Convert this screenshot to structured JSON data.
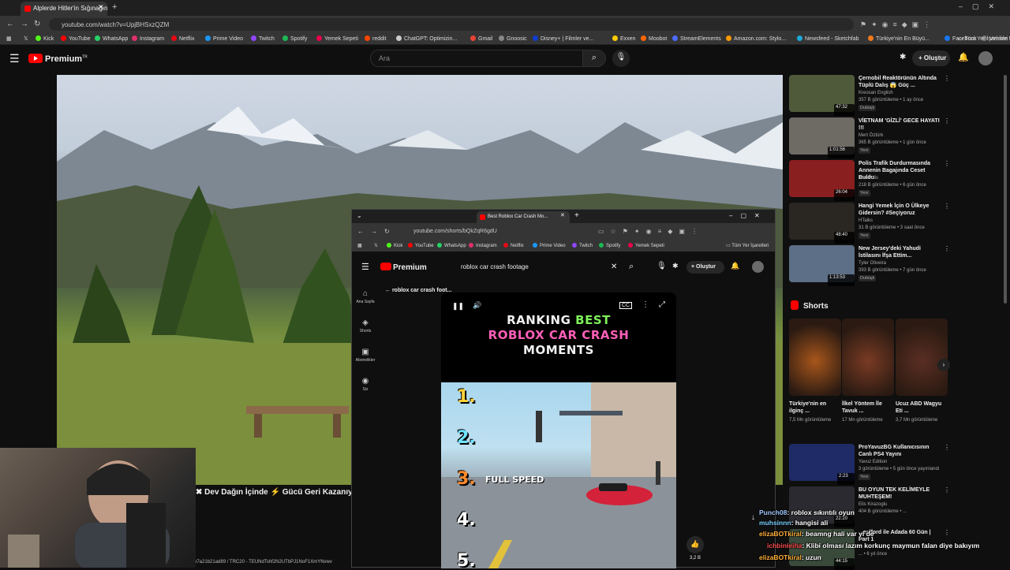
{
  "browser": {
    "active_tab_title": "Alplerde Hitler'in Sığınağın...",
    "url": "youtube.com/watch?v=UpjBHSxzQZM",
    "bookmarks": [
      {
        "label": "Kick",
        "color": "#53fc18"
      },
      {
        "label": "YouTube",
        "color": "#ff0000"
      },
      {
        "label": "WhatsApp",
        "color": "#25d366"
      },
      {
        "label": "Instagram",
        "color": "#e1306c"
      },
      {
        "label": "Netflix",
        "color": "#e50914"
      },
      {
        "label": "Prime Video",
        "color": "#1a98ff"
      },
      {
        "label": "Twitch",
        "color": "#9146ff"
      },
      {
        "label": "Spotify",
        "color": "#1db954"
      },
      {
        "label": "Yemek Sepeti",
        "color": "#ea004b"
      },
      {
        "label": "reddit",
        "color": "#ff4500"
      },
      {
        "label": "ChatGPT: Optimizin...",
        "color": "#cccccc"
      },
      {
        "label": "Gmail",
        "color": "#ea4335"
      },
      {
        "label": "Gnoosic",
        "color": "#888888"
      },
      {
        "label": "Disney+ | Filmler ve...",
        "color": "#113ccf"
      },
      {
        "label": "Exxen",
        "color": "#ffcc00"
      },
      {
        "label": "Moobot",
        "color": "#ff6600"
      },
      {
        "label": "StreamElements",
        "color": "#4d6aff"
      },
      {
        "label": "Amazon.com: Stylo...",
        "color": "#ff9900"
      },
      {
        "label": "Newsfeed - Sketchfab",
        "color": "#1caad9"
      },
      {
        "label": "Türkiye'nin En Büyü...",
        "color": "#f27a1a"
      },
      {
        "label": "Facebook",
        "color": "#1877f2"
      },
      {
        "label": "Vehicle Models - GT...",
        "color": "#777777"
      }
    ],
    "all_bookmarks": "Tüm Yer İşaretleri"
  },
  "yt": {
    "logo_text": "Premium",
    "logo_sup": "TR",
    "search_placeholder": "Ara",
    "create_label": "Oluştur"
  },
  "video": {
    "overlay_title": "Dev Dağın İçinde",
    "overlay_title_2": "Gücü Geri Kazanıyor",
    "hash_text": "b7a21b21ad89 / TRC20 - TEUNdTshf2N2UTbPJ1NoF1XmYNvwv"
  },
  "recommendations": [
    {
      "title": "Çernobil Reaktörünün Altında Tüplü Dalış 😱 Güç ...",
      "channel": "Kreosan English",
      "meta": "357 B görüntüleme • 1 ay önce",
      "badge": "Dublajlı",
      "duration": "47:32",
      "color": "#4f5a3a"
    },
    {
      "title": "VİETNAM 'GİZLİ' GECE HAYATI !!!",
      "channel": "Mert Öztürk",
      "meta": "365 B görüntüleme • 1 gün önce",
      "badge": "Yeni",
      "duration": "1:01:56",
      "color": "#6e6a64"
    },
    {
      "title": "Polis Trafik Durdurmasında Annenin Bagajında Ceset Buldu",
      "channel": "The Polis",
      "meta": "218 B görüntüleme • 6 gün önce",
      "badge": "Yeni",
      "duration": "26:04",
      "color": "#8a1f1f"
    },
    {
      "title": "Hangi Yemek İçin O Ülkeye Gidersin? #Seçiyoruz",
      "channel": "HTalks",
      "meta": "31 B görüntüleme • 3 saat önce",
      "badge": "Yeni",
      "duration": "48:40",
      "color": "#2a2622"
    },
    {
      "title": "New Jersey'deki Yahudi İstilasını İfşa Ettim...",
      "channel": "Tyler Oliveira",
      "meta": "393 B görüntüleme • 7 gün önce",
      "badge": "Dublajlı",
      "duration": "1:13:53",
      "color": "#5d6f86"
    },
    {
      "title": "ProYavuzBG Kullanıcısının Canlı PS4 Yayını",
      "channel": "Yavuz Edition",
      "meta": "3 görüntüleme • 5 gün önce yayınlandı",
      "badge": "Yeni",
      "duration": "2:23",
      "color": "#1f2b66"
    },
    {
      "title": "BU OYUN TEK KELİMEYLE MUHTEŞEM!",
      "channel": "Elis Kirazoglu",
      "meta": "404 B görüntüleme • ...",
      "badge": "",
      "duration": "22:20",
      "color": "#2a2a30"
    },
    {
      "title": "...ealford ile Adada 60 Gün | Part 1",
      "channel": "",
      "meta": "... • 6 yıl önce",
      "badge": "",
      "duration": "44:15",
      "color": "#3a4a3a"
    }
  ],
  "shorts": {
    "heading": "Shorts",
    "items": [
      {
        "title": "Türkiye'nin en ilginç ...",
        "views": "7,5 Mn görüntüleme",
        "color": "#a8561b"
      },
      {
        "title": "İlkel Yöntem İle Tavuk ...",
        "views": "17 Mn görüntüleme",
        "color": "#7a3b24"
      },
      {
        "title": "Ucuz ABD Wagyu Eti ...",
        "views": "3,7 Mn görüntüleme",
        "color": "#5a2e22"
      }
    ]
  },
  "popup": {
    "tab_title": "Best Roblox Car Crash Mo...",
    "url": "youtube.com/shorts/bQkZqR6gdU",
    "bookmarks": [
      "Kick",
      "YouTube",
      "WhatsApp",
      "Instagram",
      "Netflix",
      "Prime Video",
      "Twitch",
      "Spotify",
      "Yemek Sepeti"
    ],
    "all_bookmarks": "Tüm Yer İşaretleri",
    "search_value": "roblox car crash footage",
    "create_label": "Oluştur",
    "logo_text": "Premium",
    "breadcrumb": "roblox car crash foot...",
    "nav": [
      {
        "label": "Ana Sayfa",
        "icon": "home-icon"
      },
      {
        "label": "Shorts",
        "icon": "shorts-icon"
      },
      {
        "label": "Abonelikler",
        "icon": "subscriptions-icon"
      },
      {
        "label": "Siz",
        "icon": "you-icon"
      }
    ],
    "short": {
      "title_line1_a": "RANKING",
      "title_line1_b": "BEST",
      "title_line2": "ROBLOX CAR CRASH",
      "title_line3": "MOMENTS",
      "ranks": [
        "1.",
        "2.",
        "3.",
        "4.",
        "5."
      ],
      "full_speed": "FULL SPEED",
      "likes": "3,2 B"
    }
  },
  "chat": [
    {
      "user": "Punch08",
      "msg": ": roblox sıkıntılı oyun"
    },
    {
      "user": "muhsinnn",
      "msg": ": hangisi ali"
    },
    {
      "user": "elizaBOTkiral",
      "msg": ": beamng hali var yi de"
    },
    {
      "user": "ichbinleiha",
      "msg": ": Klibi olması lazım korkunç maymun falan diye bakıyım"
    },
    {
      "user": "elizaBOTkiral",
      "msg": ": uzun"
    }
  ]
}
